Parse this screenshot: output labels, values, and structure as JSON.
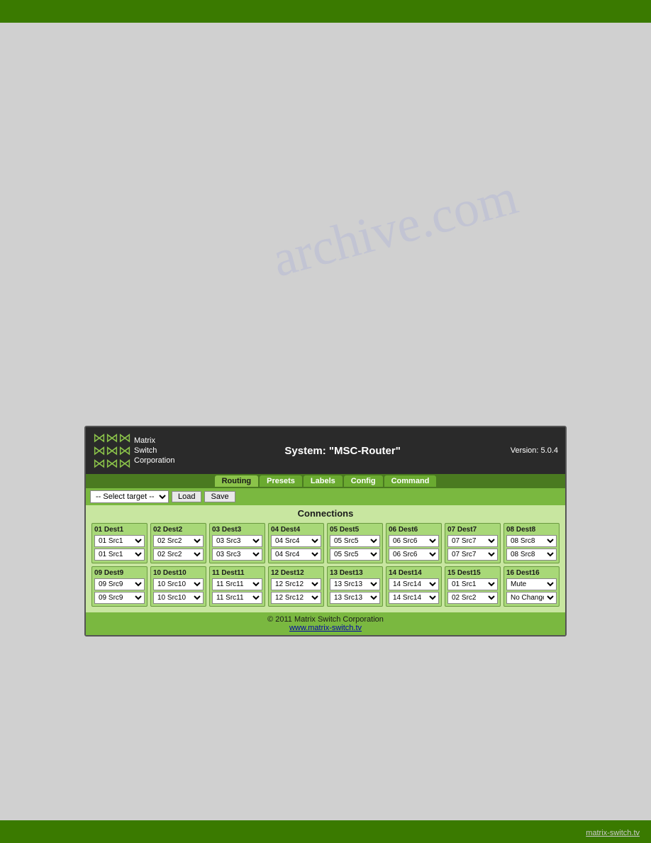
{
  "topBar": {},
  "bottomBar": {
    "text": "matrix-switch.tv"
  },
  "watermark": "archive.com",
  "ui": {
    "header": {
      "title": "System: \"MSC-Router\"",
      "version": "Version: 5.0.4",
      "logo": {
        "line1": "Matrix",
        "line2": "Switch",
        "line3": "Corporation"
      }
    },
    "nav": {
      "tabs": [
        "Routing",
        "Presets",
        "Labels",
        "Config",
        "Command"
      ],
      "activeTab": "Routing"
    },
    "controls": {
      "selectLabel": "-- Select target --",
      "loadLabel": "Load",
      "saveLabel": "Save"
    },
    "connections": {
      "title": "Connections",
      "row1": [
        {
          "destLabel": "01 Dest1",
          "src1": "01 Src1",
          "src2": "01 Src1"
        },
        {
          "destLabel": "02 Dest2",
          "src1": "02 Src2",
          "src2": "02 Src2"
        },
        {
          "destLabel": "03 Dest3",
          "src1": "03 Src3",
          "src2": "03 Src3"
        },
        {
          "destLabel": "04 Dest4",
          "src1": "04 Src4",
          "src2": "04 Src4"
        },
        {
          "destLabel": "05 Dest5",
          "src1": "05 Src5",
          "src2": "05 Src5"
        },
        {
          "destLabel": "06 Dest6",
          "src1": "06 Src6",
          "src2": "06 Src6"
        },
        {
          "destLabel": "07 Dest7",
          "src1": "07 Src7",
          "src2": "07 Src7"
        },
        {
          "destLabel": "08 Dest8",
          "src1": "08 Src8",
          "src2": "08 Src8"
        }
      ],
      "row2": [
        {
          "destLabel": "09 Dest9",
          "src1": "09 Src9",
          "src2": "09 Src9"
        },
        {
          "destLabel": "10 Dest10",
          "src1": "10 Src10",
          "src2": "10 Src10"
        },
        {
          "destLabel": "11 Dest11",
          "src1": "11 Src11",
          "src2": "11 Src11"
        },
        {
          "destLabel": "12 Dest12",
          "src1": "12 Src12",
          "src2": "12 Src12"
        },
        {
          "destLabel": "13 Dest13",
          "src1": "13 Src13",
          "src2": "13 Src13"
        },
        {
          "destLabel": "14 Dest14",
          "src1": "14 Src14",
          "src2": "14 Src14"
        },
        {
          "destLabel": "15 Dest15",
          "src1": "01 Src1",
          "src2": "02 Src2"
        },
        {
          "destLabel": "16 Dest16",
          "src1": "Mute",
          "src2": "No Change"
        }
      ]
    },
    "footer": {
      "copyright": "© 2011 Matrix Switch Corporation",
      "link": "www.matrix-switch.tv"
    }
  }
}
